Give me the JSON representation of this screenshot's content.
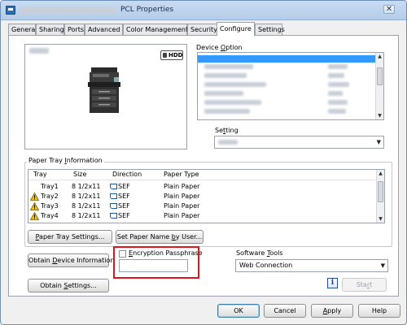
{
  "window": {
    "title": "PCL Properties",
    "close_glyph": "✕"
  },
  "tabs": [
    {
      "label": "General"
    },
    {
      "label": "Sharing"
    },
    {
      "label": "Ports"
    },
    {
      "label": "Advanced"
    },
    {
      "label": "Color Management"
    },
    {
      "label": "Security"
    },
    {
      "label": "Configure",
      "active": true
    },
    {
      "label": "Settings"
    }
  ],
  "preview": {
    "hdd_badge": "HDD"
  },
  "device_option": {
    "label_pre": "Device ",
    "label_u": "O",
    "label_post": "ption"
  },
  "setting": {
    "label_pre": "Se",
    "label_u": "t",
    "label_post": "ting"
  },
  "paper_tray": {
    "legend_pre": "Paper Tray ",
    "legend_u": "I",
    "legend_post": "nformation",
    "columns": [
      "Tray",
      "Size",
      "Direction",
      "Paper Type"
    ],
    "rows": [
      {
        "tray": "Tray1",
        "size": "8 1/2x11",
        "direction": "SEF",
        "paper_type": "Plain Paper",
        "warning": false
      },
      {
        "tray": "Tray2",
        "size": "8 1/2x11",
        "direction": "SEF",
        "paper_type": "Plain Paper",
        "warning": true
      },
      {
        "tray": "Tray3",
        "size": "8 1/2x11",
        "direction": "SEF",
        "paper_type": "Plain Paper",
        "warning": true
      },
      {
        "tray": "Tray4",
        "size": "8 1/2x11",
        "direction": "SEF",
        "paper_type": "Plain Paper",
        "warning": true
      }
    ],
    "settings_button": {
      "pre": "",
      "u": "P",
      "post": "aper Tray Settings..."
    },
    "set_name_button": {
      "pre": "Set Paper Name ",
      "u": "b",
      "post": "y User..."
    }
  },
  "obtain_device_button": {
    "pre": "Obtain ",
    "u": "D",
    "post": "evice Information"
  },
  "obtain_settings_button": {
    "pre": "Obtain ",
    "u": "S",
    "post": "ettings..."
  },
  "encryption": {
    "label_pre": "",
    "label_u": "E",
    "label_post": "ncryption Passphrase",
    "checked": false,
    "value": ""
  },
  "software_tools": {
    "label_pre": "Software ",
    "label_u": "T",
    "label_post": "ools",
    "selected": "Web Connection",
    "start_pre": "Sta",
    "start_u": "r",
    "start_post": "t"
  },
  "footer": {
    "ok": "OK",
    "cancel": "Cancel",
    "apply_u": "A",
    "apply_post": "pply",
    "help": "Help"
  },
  "colors": {
    "highlight_box": "#e0141c",
    "warning": "#f2c200"
  }
}
